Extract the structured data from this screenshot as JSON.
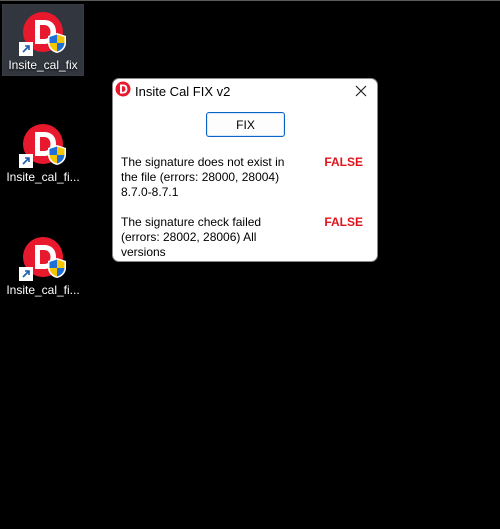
{
  "desktop": {
    "icons": [
      {
        "label": "Insite_cal_fix"
      },
      {
        "label": "Insite_cal_fi..."
      },
      {
        "label": "Insite_cal_fi..."
      }
    ]
  },
  "dialog": {
    "title": "Insite Cal FIX v2",
    "close_glyph": "×",
    "fix_button_label": "FIX",
    "checks": [
      {
        "text": "The signature does not exist in the file (errors: 28000, 28004) 8.7.0-8.7.1",
        "status": "FALSE"
      },
      {
        "text": "The signature check failed (errors: 28002, 28006) All versions",
        "status": "FALSE"
      }
    ]
  },
  "colors": {
    "desktop_background": "#000000",
    "status_false": "#e0141b",
    "icon_red": "#e8192c",
    "fix_button_border": "#0b63c8"
  }
}
